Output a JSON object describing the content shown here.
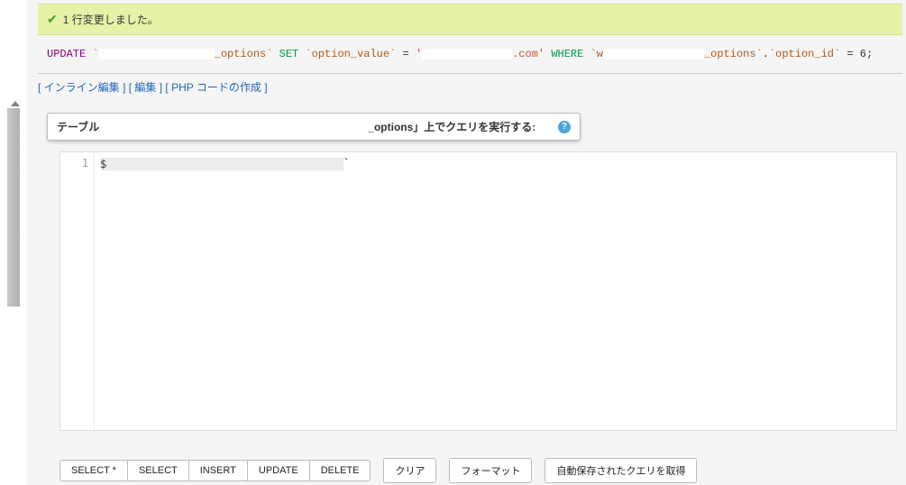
{
  "success_message": "1 行変更しました。",
  "sql": {
    "update_kw": "UPDATE",
    "tbl_prefix_tick": "`",
    "tbl_suffix": "_options`",
    "set_kw": "SET",
    "col1": "`option_value`",
    "eq": "=",
    "str_quote": "'",
    "val_tail": ".com'",
    "where_kw": "WHERE",
    "tbl_ref_prefix": "`w",
    "tbl_ref_suffix": "_options`",
    "dot": ".",
    "col2": "`option_id`",
    "eq2": "=",
    "val_int": "6",
    "semi": ";"
  },
  "links": {
    "inline_edit": "インライン編集",
    "edit": "編集",
    "php_code": "PHP コードの作成"
  },
  "tableHeader": {
    "label": "テーブル",
    "rest": "_options」上でクエリを実行する:"
  },
  "editor": {
    "line_number": "1",
    "content_start": "$",
    "content_end": "`"
  },
  "buttons": {
    "group1": [
      "SELECT *",
      "SELECT",
      "INSERT",
      "UPDATE",
      "DELETE"
    ],
    "clear": "クリア",
    "format": "フォーマット",
    "autosave": "自動保存されたクエリを取得"
  }
}
